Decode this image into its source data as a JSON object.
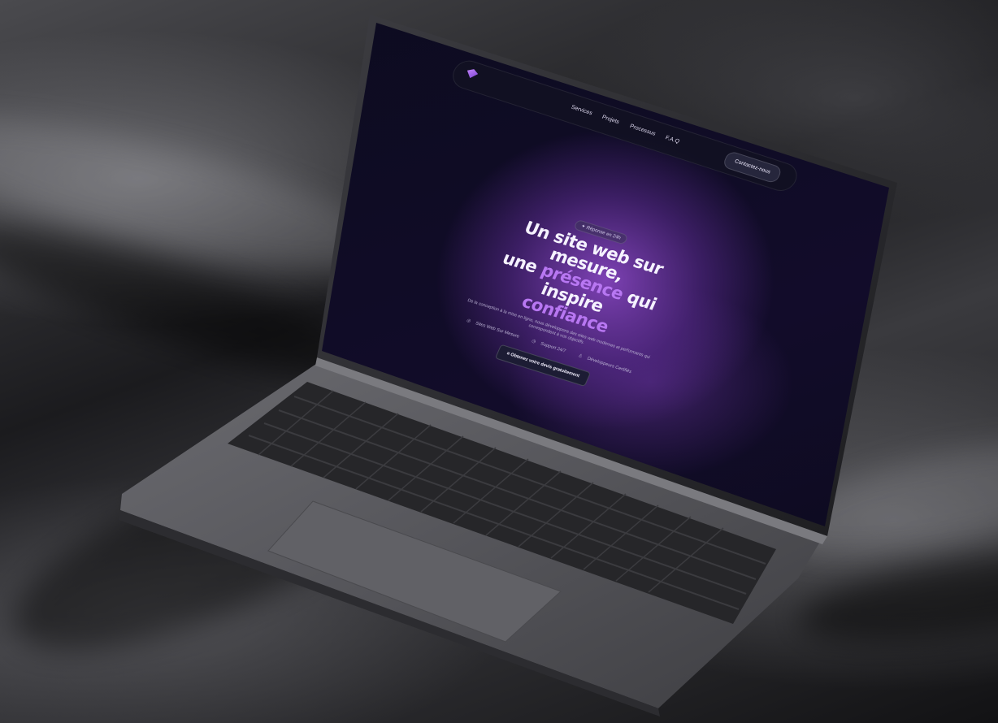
{
  "nav": {
    "links": [
      "Services",
      "Projets",
      "Processus",
      "F.A.Q"
    ],
    "cta": "Contactez-nous"
  },
  "hero": {
    "badge": "Réponse en 24h",
    "title_line1": "Un site web sur mesure,",
    "title_line2_a": "une ",
    "title_line2_accent": "présence",
    "title_line2_b": " qui inspire",
    "title_line3_accent": "confiance",
    "subtitle": "De la conception à la mise en ligne, nous développons des sites web modernes et performants qui correspondent à vos objectifs.",
    "features": [
      "Sites Web Sur Mesure",
      "Support 24/7",
      "Développeurs Certifiés"
    ],
    "button": "Obtenez votre devis gratuitement"
  },
  "colors": {
    "accent": "#b877f2",
    "screen_bg": "#0b0b1d",
    "laptop_body": "#59595d"
  }
}
